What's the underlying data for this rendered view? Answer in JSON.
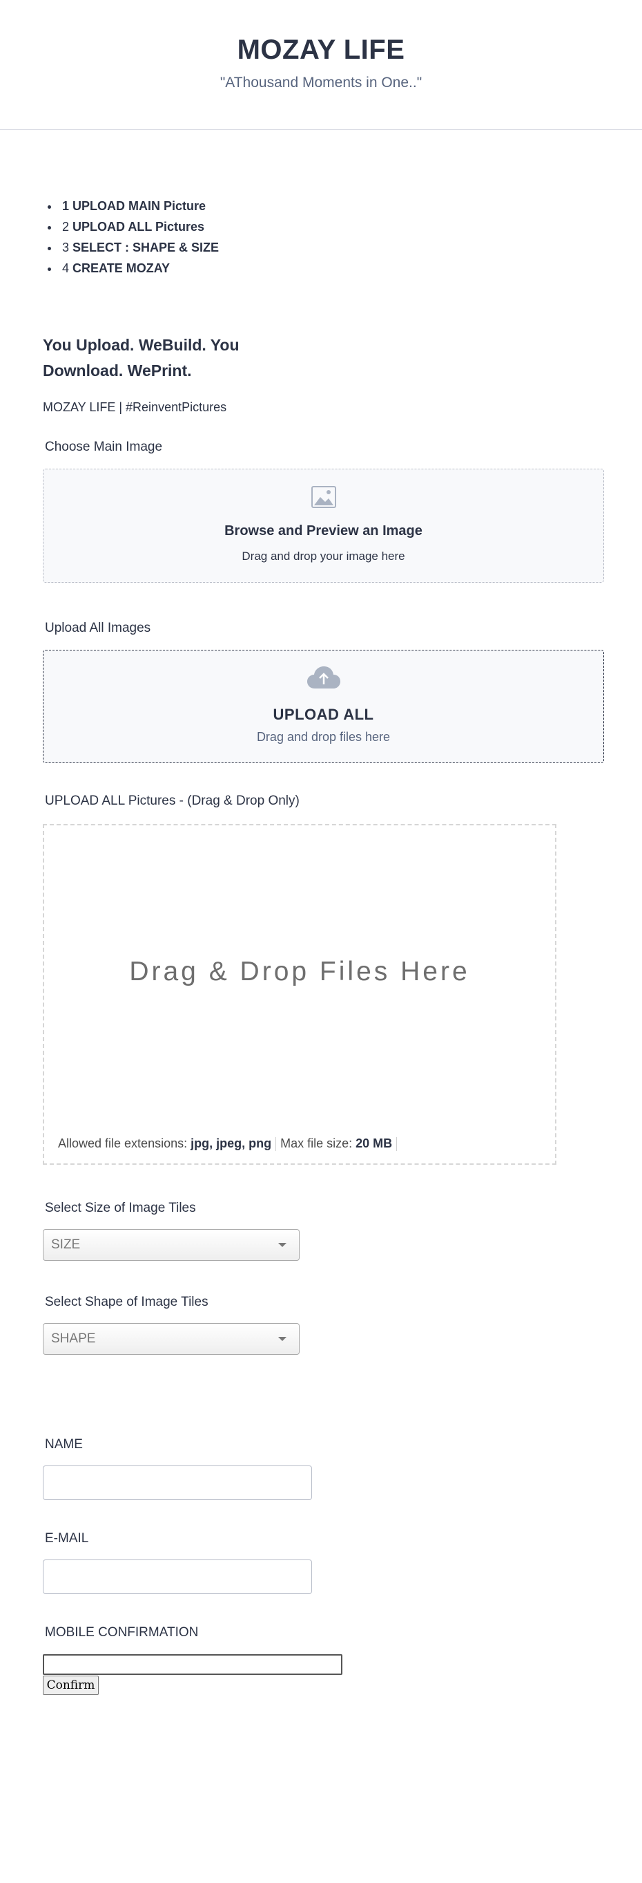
{
  "header": {
    "title": "MOZAY LIFE",
    "subtitle": "\"AThousand Moments in One..\""
  },
  "steps": [
    {
      "num": "1",
      "text": "UPLOAD MAIN Picture"
    },
    {
      "num": "2",
      "text": "UPLOAD ALL Pictures"
    },
    {
      "num": "3",
      "text": "SELECT : SHAPE & SIZE"
    },
    {
      "num": "4",
      "text": "CREATE MOZAY"
    }
  ],
  "tagline": "You Upload. WeBuild. You Download. WePrint.",
  "hashline": "MOZAY LIFE | #ReinventPictures",
  "main_image": {
    "label": "Choose Main Image",
    "icon": "image-icon",
    "title": "Browse and Preview an Image",
    "hint": "Drag and drop your image here"
  },
  "upload_all": {
    "label": "Upload All Images",
    "icon": "cloud-upload-icon",
    "title": "UPLOAD ALL",
    "hint": "Drag and drop files here"
  },
  "dragdrop": {
    "label": "UPLOAD ALL Pictures - (Drag & Drop Only)",
    "text": "Drag & Drop Files Here",
    "ext_label": "Allowed file extensions:",
    "ext_value": "jpg, jpeg, png",
    "size_label": "Max file size:",
    "size_value": "20 MB"
  },
  "size_select": {
    "label": "Select Size of Image Tiles",
    "value": "SIZE"
  },
  "shape_select": {
    "label": "Select Shape of Image Tiles",
    "value": "SHAPE"
  },
  "form": {
    "name_label": "NAME",
    "email_label": "E-MAIL",
    "mobile_label": "MOBILE CONFIRMATION",
    "confirm_label": "Confirm"
  },
  "colors": {
    "text": "#2c3345",
    "muted": "#57647e",
    "dropbox_bg": "#f8f9fb",
    "icon": "#aab3c2"
  }
}
